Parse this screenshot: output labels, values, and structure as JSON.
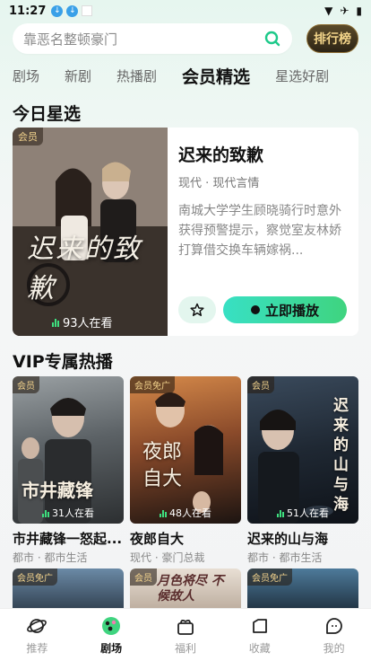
{
  "status": {
    "time": "11:27"
  },
  "search": {
    "placeholder": "靠恶名整顿豪门",
    "rank_label": "排行榜"
  },
  "tabs": [
    {
      "label": "剧场"
    },
    {
      "label": "新剧"
    },
    {
      "label": "热播剧"
    },
    {
      "label": "会员精选"
    },
    {
      "label": "星选好剧"
    }
  ],
  "today": {
    "section_title": "今日星选",
    "badge": "会员",
    "poster_text": "迟来的致歉",
    "watchers": "93人在看",
    "title": "迟来的致歉",
    "tags": "现代 · 现代言情",
    "desc": "南城大学学生顾晓骑行时意外获得预警提示，察觉室友林娇打算借交换车辆嫁祸...",
    "play_label": "立即播放"
  },
  "vip": {
    "section_title": "VIP专属热播",
    "cards": [
      {
        "badge": "会员",
        "poster_text": "市井藏锋",
        "watchers": "31人在看",
        "title": "市井藏锋一怒起...",
        "tags": "都市 · 都市生活"
      },
      {
        "badge": "会员免广",
        "poster_text": "夜郎自大",
        "watchers": "48人在看",
        "title": "夜郎自大",
        "tags": "现代 · 豪门总裁"
      },
      {
        "badge": "会员",
        "poster_text": "迟来的山与海",
        "watchers": "51人在看",
        "title": "迟来的山与海",
        "tags": "都市 · 都市生活"
      }
    ],
    "row2": [
      {
        "badge": "会员免广",
        "poster_text": ""
      },
      {
        "badge": "会员",
        "poster_text": "月色将尽 不候故人"
      },
      {
        "badge": "会员免广",
        "poster_text": ""
      }
    ]
  },
  "nav": [
    {
      "label": "推荐",
      "icon": "planet-icon"
    },
    {
      "label": "剧场",
      "icon": "theater-icon"
    },
    {
      "label": "福利",
      "icon": "gift-icon"
    },
    {
      "label": "收藏",
      "icon": "bookmark-icon"
    },
    {
      "label": "我的",
      "icon": "profile-icon"
    }
  ],
  "colors": {
    "accent": "#3fd47f",
    "accent_cyan": "#38e0c4",
    "rank_gold": "#f3d58a"
  }
}
